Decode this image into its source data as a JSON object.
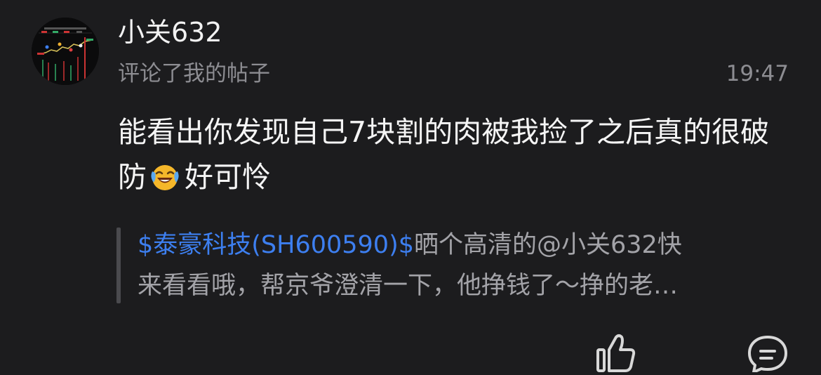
{
  "user": {
    "name": "小关632",
    "action": "评论了我的帖子",
    "time": "19:47"
  },
  "comment": {
    "text_before_emoji": "能看出你发现自己7块割的肉被我捡了之后真的很破防",
    "emoji": "laughing-crying-emoji",
    "text_after_emoji": "好可怜"
  },
  "quoted_post": {
    "stock_link": "$泰豪科技(SH600590)$",
    "line1_rest": "晒个高清的@小关632快",
    "line2": "来看看哦，帮京爷澄清一下，他挣钱了～挣的老…"
  },
  "actions": {
    "like_icon": "thumbs-up-icon",
    "comment_icon": "comment-bubble-icon"
  },
  "colors": {
    "background": "#1c1c1e",
    "link": "#3d7ff0",
    "secondary_text": "#8d8d92"
  }
}
